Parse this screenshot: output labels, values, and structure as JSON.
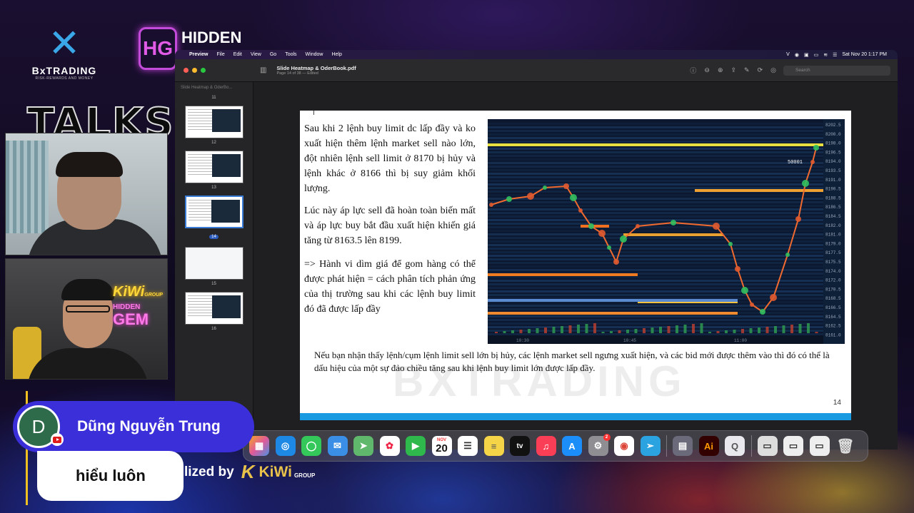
{
  "stream": {
    "brand_bx": "BxTRADING",
    "brand_bx_tag": "RISK-REWARDS AND MONEY",
    "brand_hg": "HIDDEN",
    "talkshow": "TALKS",
    "sponsor_prefix": "lized by",
    "sponsor_name": "KiWi",
    "sponsor_group": "GROUP",
    "neon_kiwi": "KiWi",
    "neon_kiwi_group": "GROUP",
    "neon_hidden": "HIDDEN",
    "neon_gem": "GEM"
  },
  "menubar": {
    "app": "Preview",
    "items": [
      "File",
      "Edit",
      "View",
      "Go",
      "Tools",
      "Window",
      "Help"
    ],
    "datetime": "Sat Nov 20  1:17 PM"
  },
  "toolbar": {
    "title": "Slide Heatmap & OderBook.pdf",
    "subtitle": "Page 14 of 38 — Edited",
    "search_placeholder": "Search"
  },
  "sidebar": {
    "header": "Slide Heatmap & OderBo...",
    "pages": [
      "11",
      "12",
      "13",
      "14",
      "15",
      "16"
    ],
    "selected": "14"
  },
  "slide": {
    "p1": "Sau khi 2 lệnh buy limit dc lấp đầy và ko xuất hiện thêm lệnh market sell nào lớn, đột nhiên lệnh sell limit ở 8170 bị hủy và lệnh khác ở 8166 thì bị suy giảm khối lượng.",
    "p2": "Lúc này áp lực sell đã hoàn toàn biến mất và áp lực buy bắt đầu xuất hiện khiến giá tăng từ 8163.5 lên 8199.",
    "p3": "=> Hành vi dìm giá để gom hàng có thể được phát hiện = cách  phân tích phản ứng của thị trường sau khi các lệnh buy limit đó đã được lấp đầy",
    "bottom": "Nếu bạn nhận thấy lệnh/cụm lệnh limit sell lớn bị hủy, các lệnh market sell ngưng xuất hiện, và các bid mới được thêm vào thì đó có thể là dấu hiệu của một sự đảo chiều tăng sau khi lệnh buy limit lớn được lấp đầy.",
    "watermark": "BXTRADING",
    "page_number": "14",
    "chart_label": "50001",
    "chart_times": [
      "10:30",
      "10:45",
      "11:00"
    ],
    "price_ticks": [
      "8202.5",
      "8200.0",
      "8198.0",
      "8196.5",
      "8194.0",
      "8193.5",
      "8191.0",
      "8190.5",
      "8188.5",
      "8186.5",
      "8184.5",
      "8182.0",
      "8181.0",
      "8179.0",
      "8177.5",
      "8175.5",
      "8174.0",
      "8172.0",
      "8170.5",
      "8168.5",
      "8166.5",
      "8164.5",
      "8162.5",
      "8161.0"
    ]
  },
  "dock": {
    "calendar_month": "NOV",
    "calendar_day": "20",
    "appletv": "tv",
    "illustrator": "Ai",
    "settings_badge": "2"
  },
  "comment": {
    "avatar_letter": "D",
    "author": "Dũng Nguyễn Trung",
    "text": "hiểu luôn"
  }
}
